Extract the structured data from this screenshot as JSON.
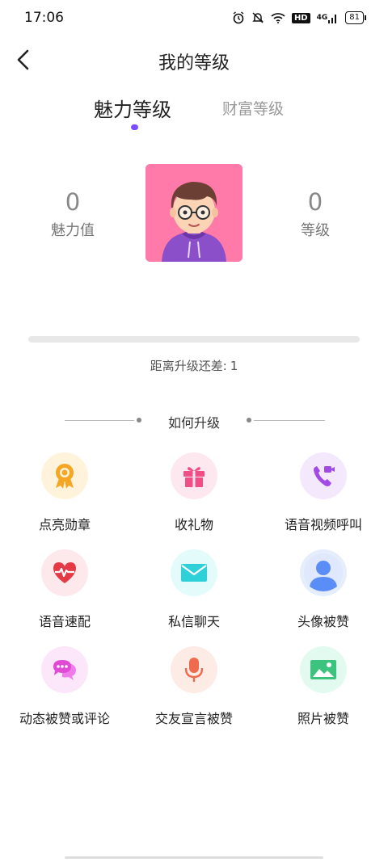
{
  "status": {
    "time": "17:06",
    "network": "4G",
    "battery": "81",
    "hd": "HD"
  },
  "header": {
    "title": "我的等级"
  },
  "tabs": [
    {
      "label": "魅力等级",
      "active": true
    },
    {
      "label": "财富等级",
      "active": false
    }
  ],
  "stats": {
    "charm_value": "0",
    "charm_label": "魅力值",
    "level_value": "0",
    "level_label": "等级"
  },
  "progress": {
    "text": "距离升级还差:",
    "remaining": "1",
    "fraction": 0
  },
  "how_to": {
    "title": "如何升级"
  },
  "items": [
    {
      "label": "点亮勋章",
      "icon": "medal-icon",
      "bg": "#fff3dc",
      "color": "#f5a623"
    },
    {
      "label": "收礼物",
      "icon": "gift-icon",
      "bg": "#fde8ef",
      "color": "#ef4f86"
    },
    {
      "label": "语音视频呼叫",
      "icon": "phone-video-icon",
      "bg": "#f4e8fd",
      "color": "#a24ae6"
    },
    {
      "label": "语音速配",
      "icon": "heartbeat-icon",
      "bg": "#fde8ec",
      "color": "#e63946"
    },
    {
      "label": "私信聊天",
      "icon": "mail-icon",
      "bg": "#e3fbfb",
      "color": "#2fd1d9"
    },
    {
      "label": "头像被赞",
      "icon": "user-icon",
      "bg": "#e6eefc",
      "color": "#5a8ef6"
    },
    {
      "label": "动态被赞或评论",
      "icon": "chat-bubble-icon",
      "bg": "#fbe6fa",
      "color": "#e04ad5"
    },
    {
      "label": "交友宣言被赞",
      "icon": "microphone-icon",
      "bg": "#fdebe6",
      "color": "#f06a4d"
    },
    {
      "label": "照片被赞",
      "icon": "image-icon",
      "bg": "#e3faf0",
      "color": "#3cc47f"
    }
  ]
}
